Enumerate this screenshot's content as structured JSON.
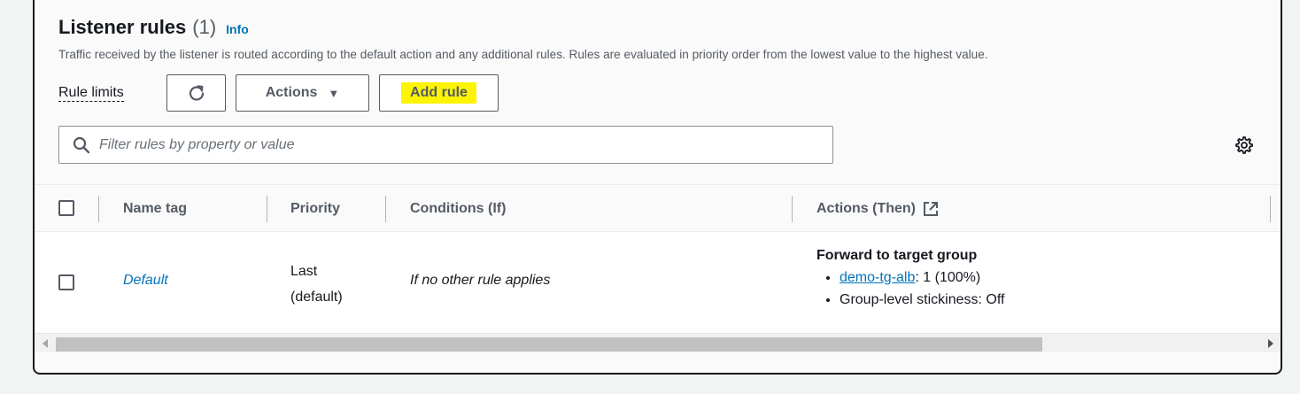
{
  "header": {
    "title": "Listener rules",
    "count": "(1)",
    "info_label": "Info",
    "description": "Traffic received by the listener is routed according to the default action and any additional rules. Rules are evaluated in priority order from the lowest value to the highest value."
  },
  "toolbar": {
    "rule_limits_label": "Rule limits",
    "refresh_icon": "refresh-icon",
    "actions_label": "Actions",
    "actions_caret": "▼",
    "add_rule_label": "Add rule",
    "highlight_color": "#fcf400"
  },
  "search": {
    "placeholder": "Filter rules by property or value",
    "value": ""
  },
  "table": {
    "columns": [
      "Name tag",
      "Priority",
      "Conditions (If)",
      "Actions (Then)"
    ],
    "rows": [
      {
        "name": "Default",
        "priority_line1": "Last",
        "priority_line2": "(default)",
        "condition": "If no other rule applies",
        "action_title": "Forward to target group",
        "target_group": "demo-tg-alb",
        "target_weight": ": 1 (100%)",
        "stickiness": "Group-level stickiness: Off"
      }
    ]
  },
  "colors": {
    "link": "#0073bb",
    "text": "#16191f",
    "muted": "#545b64"
  }
}
